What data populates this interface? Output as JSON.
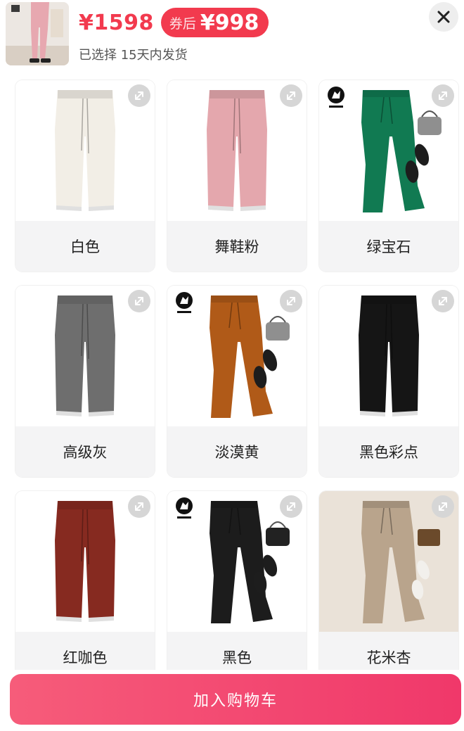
{
  "header": {
    "original_price": "¥1598",
    "coupon_tag": "券后",
    "coupon_price": "¥998",
    "selected_text": "已选择 15天内发货"
  },
  "variants": [
    {
      "label": "白色",
      "pants_color": "#f2eee6",
      "style": "plain"
    },
    {
      "label": "舞鞋粉",
      "pants_color": "#e4a7ad",
      "style": "plain"
    },
    {
      "label": "绿宝石",
      "pants_color": "#117a52",
      "style": "styled"
    },
    {
      "label": "高级灰",
      "pants_color": "#6e6e6e",
      "style": "plain"
    },
    {
      "label": "淡漠黄",
      "pants_color": "#b05a18",
      "style": "styled"
    },
    {
      "label": "黑色彩点",
      "pants_color": "#151515",
      "style": "plain"
    },
    {
      "label": "红咖色",
      "pants_color": "#862a20",
      "style": "plain"
    },
    {
      "label": "黑色",
      "pants_color": "#1c1c1c",
      "style": "styled-bag"
    },
    {
      "label": "花米杏",
      "pants_color": "#b9a48c",
      "style": "beige-bg"
    }
  ],
  "footer": {
    "add_to_cart_label": "加入购物车"
  },
  "colors": {
    "accent": "#f23a4e",
    "button_gradient_start": "#f65c7a",
    "button_gradient_end": "#f0386a"
  }
}
